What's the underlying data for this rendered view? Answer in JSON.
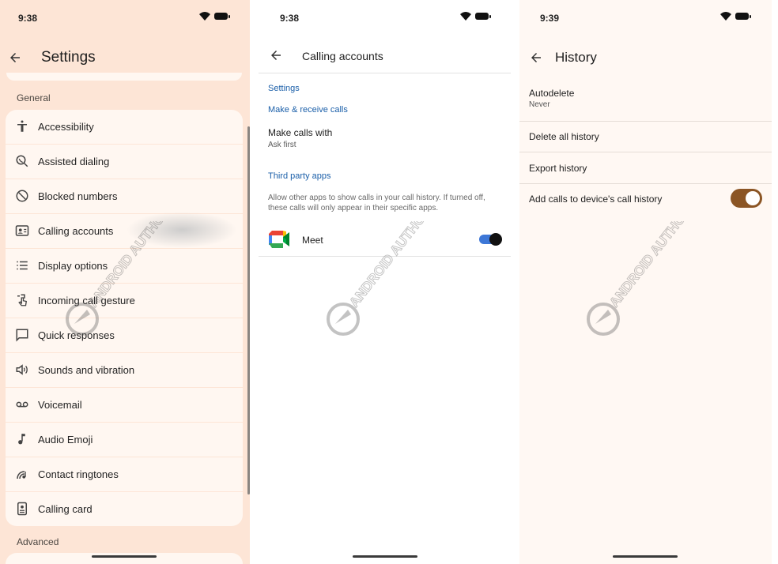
{
  "screens": {
    "settings": {
      "time": "9:38",
      "title": "Settings",
      "general_label": "General",
      "advanced_label": "Advanced",
      "items": [
        {
          "label": "Accessibility",
          "icon": "accessibility-icon"
        },
        {
          "label": "Assisted dialing",
          "icon": "assisted-dialing-icon"
        },
        {
          "label": "Blocked numbers",
          "icon": "block-icon"
        },
        {
          "label": "Calling accounts",
          "icon": "calling-accounts-icon"
        },
        {
          "label": "Display options",
          "icon": "list-icon"
        },
        {
          "label": "Incoming call gesture",
          "icon": "gesture-icon"
        },
        {
          "label": "Quick responses",
          "icon": "chat-icon"
        },
        {
          "label": "Sounds and vibration",
          "icon": "speaker-icon"
        },
        {
          "label": "Voicemail",
          "icon": "voicemail-icon"
        },
        {
          "label": "Audio Emoji",
          "icon": "music-note-icon"
        },
        {
          "label": "Contact ringtones",
          "icon": "ringtone-icon"
        },
        {
          "label": "Calling card",
          "icon": "calling-card-icon"
        }
      ]
    },
    "calling_accounts": {
      "time": "9:38",
      "title": "Calling accounts",
      "settings_head": "Settings",
      "make_receive_head": "Make & receive calls",
      "make_calls_with": "Make calls with",
      "make_calls_value": "Ask first",
      "third_party_head": "Third party apps",
      "third_party_desc": "Allow other apps to show calls in your call history. If turned off, these calls will only appear in their specific apps.",
      "meet_label": "Meet",
      "meet_enabled": true
    },
    "history": {
      "time": "9:39",
      "title": "History",
      "autodelete_label": "Autodelete",
      "autodelete_value": "Never",
      "delete_all": "Delete all history",
      "export": "Export history",
      "add_calls": "Add calls to device's call history",
      "add_calls_enabled": true
    }
  },
  "watermark": "ANDROID AUTHORITY",
  "colors": {
    "settings_bg": "#fde5d6",
    "card_bg": "#fff7f1",
    "link_blue": "#1b5fa9",
    "toggle_brown": "#8b5524",
    "toggle_blue": "#3d77d7"
  }
}
